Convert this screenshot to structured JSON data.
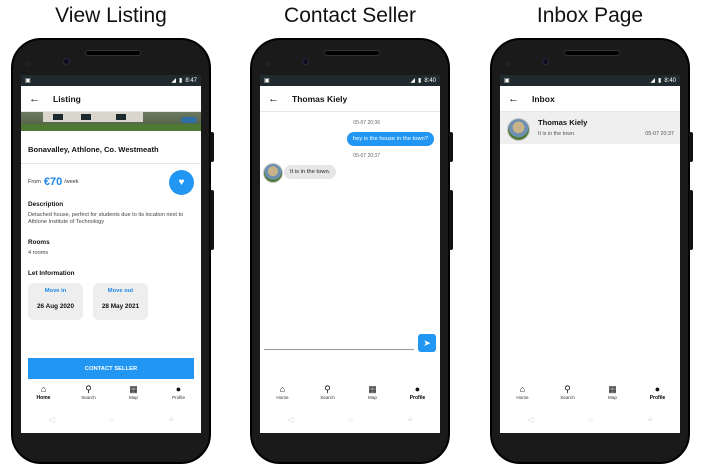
{
  "captions": [
    "View Listing",
    "Contact Seller",
    "Inbox Page"
  ],
  "status": {
    "time1": "8:47",
    "time2": "8:40",
    "time3": "8:40"
  },
  "listing": {
    "title": "Listing",
    "address": "Bonavalley, Athlone, Co. Westmeath",
    "from": "From",
    "price": "€70",
    "per": "/week",
    "description_heading": "Description",
    "description": "Detached house, perfect for students due to its location next to Athlone Institute of Technology",
    "rooms_heading": "Rooms",
    "rooms": "4 rooms",
    "let_heading": "Let Information",
    "move_in_label": "Move in",
    "move_in": "26 Aug 2020",
    "move_out_label": "Move out",
    "move_out": "28 May 2021",
    "contact_button": "CONTACT SELLER"
  },
  "chat": {
    "title": "Thomas Kiely",
    "messages": [
      {
        "time": "05-07 20:36",
        "text": "hey is the house in the town?",
        "dir": "out"
      },
      {
        "time": "05-07 20:37",
        "text": "It is in the town.",
        "dir": "in"
      }
    ]
  },
  "inbox": {
    "title": "Inbox",
    "rows": [
      {
        "name": "Thomas Kiely",
        "message": "It is in the town.",
        "time": "05-07 20:37"
      }
    ]
  },
  "nav": {
    "home": "Home",
    "search": "Search",
    "map": "Map",
    "profile": "Profile"
  },
  "icons": [
    "back-arrow-icon",
    "heart-icon",
    "home-icon",
    "search-icon",
    "map-icon",
    "profile-icon",
    "send-icon"
  ],
  "colors": {
    "accent": "#2196f3",
    "statusbar": "#202a2e"
  }
}
